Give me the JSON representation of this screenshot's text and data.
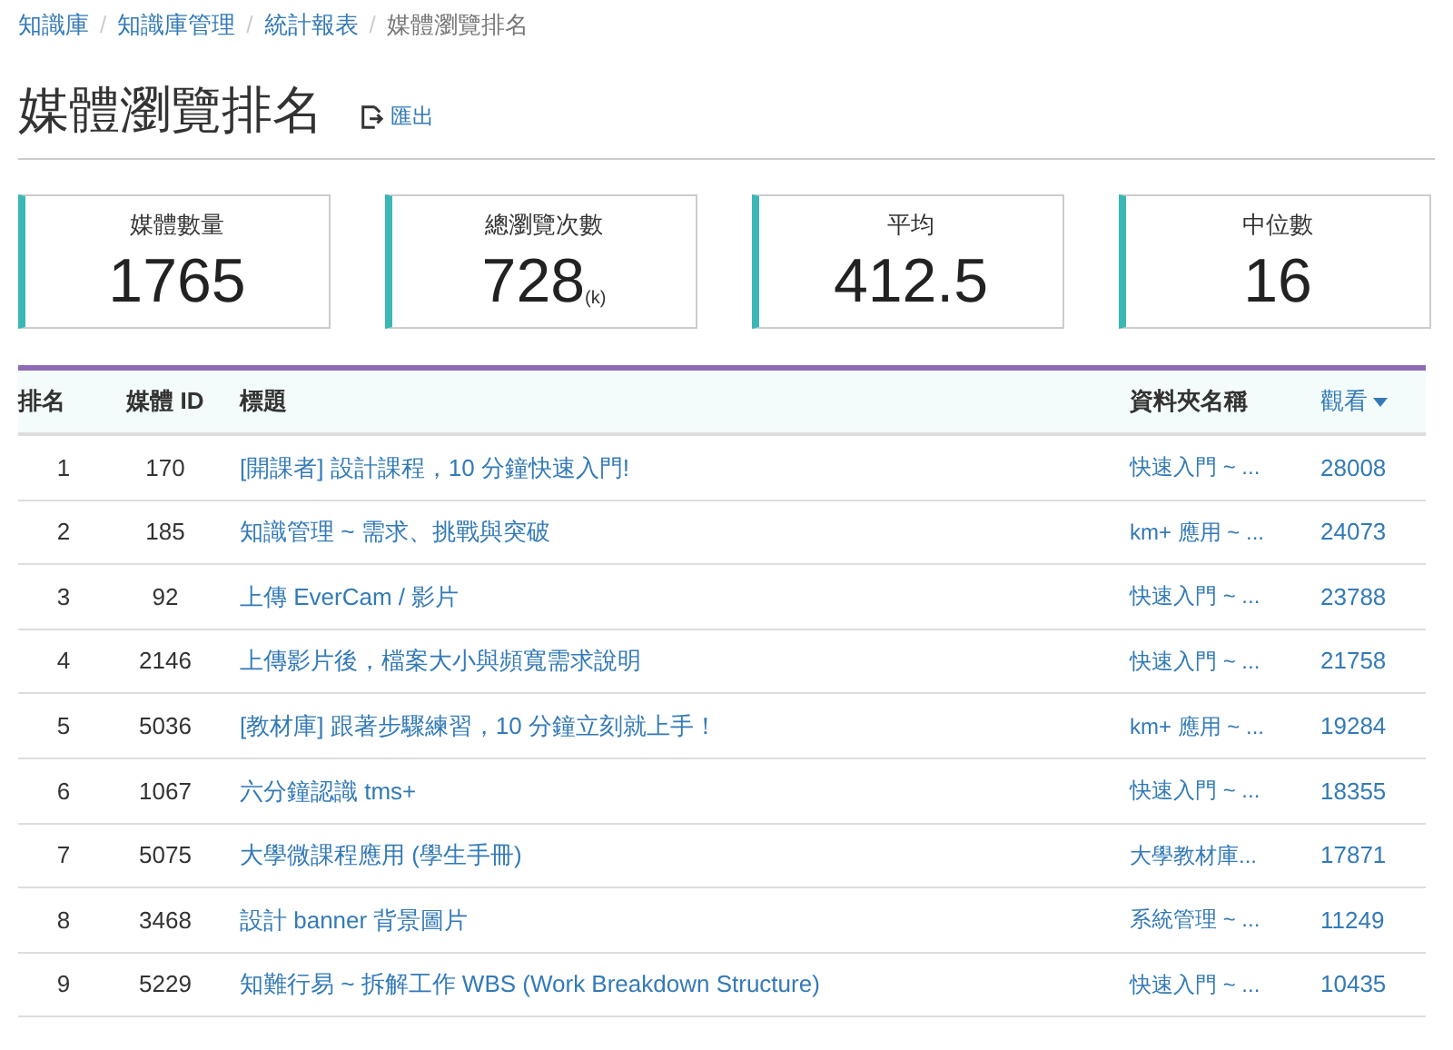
{
  "breadcrumb_separator": "/",
  "breadcrumb": [
    {
      "label": "知識庫",
      "link": true
    },
    {
      "label": "知識庫管理",
      "link": true
    },
    {
      "label": "統計報表",
      "link": true
    },
    {
      "label": "媒體瀏覽排名",
      "link": false
    }
  ],
  "page_title": "媒體瀏覽排名",
  "export_link": "匯出",
  "stats": [
    {
      "label": "媒體數量",
      "value": "1765"
    },
    {
      "label": "總瀏覽次數",
      "value": "728",
      "unit": "(k)"
    },
    {
      "label": "平均",
      "value": "412.5"
    },
    {
      "label": "中位數",
      "value": "16"
    }
  ],
  "table": {
    "columns": [
      {
        "label": "排名",
        "sorted": false
      },
      {
        "label": "媒體 ID",
        "sorted": false
      },
      {
        "label": "標題",
        "sorted": false
      },
      {
        "label": "資料夾名稱",
        "sorted": false
      },
      {
        "label": "觀看",
        "sorted": true
      }
    ],
    "rows": [
      [
        "1",
        "170",
        "[開課者] 設計課程，10 分鐘快速入門!",
        "快速入門 ~ ...",
        "28008"
      ],
      [
        "2",
        "185",
        "知識管理 ~ 需求、挑戰與突破",
        "km+ 應用 ~ ...",
        "24073"
      ],
      [
        "3",
        "92",
        "上傳 EverCam / 影片",
        "快速入門 ~ ...",
        "23788"
      ],
      [
        "4",
        "2146",
        "上傳影片後，檔案大小與頻寬需求說明",
        "快速入門 ~ ...",
        "21758"
      ],
      [
        "5",
        "5036",
        "[教材庫] 跟著步驟練習，10 分鐘立刻就上手！",
        "km+ 應用 ~ ...",
        "19284"
      ],
      [
        "6",
        "1067",
        "六分鐘認識 tms+",
        "快速入門 ~ ...",
        "18355"
      ],
      [
        "7",
        "5075",
        "大學微課程應用 (學生手冊)",
        "大學教材庫...",
        "17871"
      ],
      [
        "8",
        "3468",
        "設計 banner 背景圖片",
        "系統管理 ~ ...",
        "11249"
      ],
      [
        "9",
        "5229",
        "知難行易 ~ 拆解工作 WBS (Work Breakdown Structure)",
        "快速入門 ~ ...",
        "10435"
      ]
    ]
  }
}
